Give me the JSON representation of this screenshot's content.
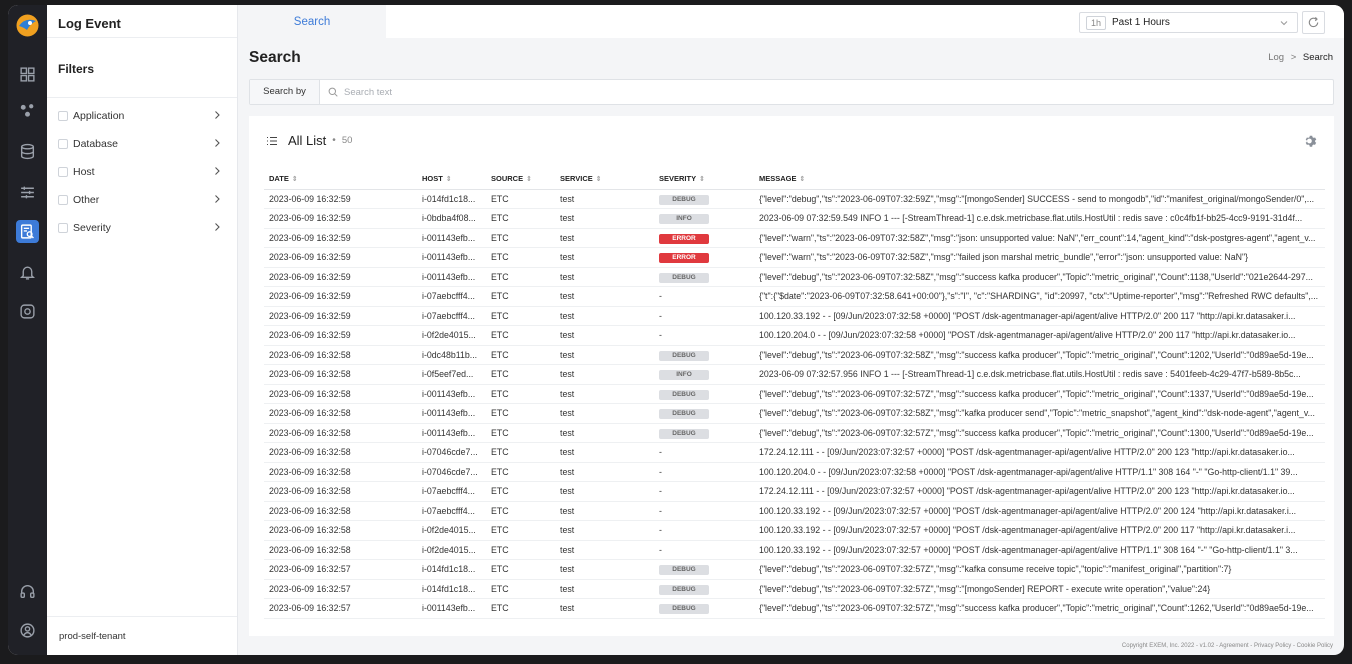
{
  "app": {
    "title": "Log Event",
    "tenant": "prod-self-tenant"
  },
  "filters": {
    "title": "Filters",
    "items": [
      {
        "label": "Application"
      },
      {
        "label": "Database"
      },
      {
        "label": "Host"
      },
      {
        "label": "Other"
      },
      {
        "label": "Severity"
      }
    ]
  },
  "topbar": {
    "tab_label": "Search",
    "time_badge": "1h",
    "time_label": "Past 1 Hours"
  },
  "page": {
    "title": "Search",
    "breadcrumb": {
      "root": "Log",
      "sep": ">",
      "current": "Search"
    }
  },
  "search": {
    "by_label": "Search by",
    "placeholder": "Search text"
  },
  "list": {
    "title": "All List",
    "dot": "•",
    "count": "50",
    "columns": [
      "DATE",
      "HOST",
      "SOURCE",
      "SERVICE",
      "SEVERITY",
      "MESSAGE"
    ],
    "sort_glyph": "⇕",
    "rows": [
      {
        "date": "2023-06-09 16:32:59",
        "host": "i-014fd1c18...",
        "source": "ETC",
        "service": "test",
        "severity": "DEBUG",
        "message": "{\"level\":\"debug\",\"ts\":\"2023-06-09T07:32:59Z\",\"msg\":\"[mongoSender] SUCCESS - send to mongodb\",\"id\":\"manifest_original/mongoSender/0\",..."
      },
      {
        "date": "2023-06-09 16:32:59",
        "host": "i-0bdba4f08...",
        "source": "ETC",
        "service": "test",
        "severity": "INFO",
        "message": "2023-06-09 07:32:59.549 INFO 1 --- [-StreamThread-1] c.e.dsk.metricbase.flat.utils.HostUtil : redis save : c0c4fb1f-bb25-4cc9-9191-31d4f..."
      },
      {
        "date": "2023-06-09 16:32:59",
        "host": "i-001143efb...",
        "source": "ETC",
        "service": "test",
        "severity": "ERROR",
        "message": "{\"level\":\"warn\",\"ts\":\"2023-06-09T07:32:58Z\",\"msg\":\"json: unsupported value: NaN\",\"err_count\":14,\"agent_kind\":\"dsk-postgres-agent\",\"agent_v..."
      },
      {
        "date": "2023-06-09 16:32:59",
        "host": "i-001143efb...",
        "source": "ETC",
        "service": "test",
        "severity": "ERROR",
        "message": "{\"level\":\"warn\",\"ts\":\"2023-06-09T07:32:58Z\",\"msg\":\"failed json marshal metric_bundle\",\"error\":\"json: unsupported value: NaN\"}"
      },
      {
        "date": "2023-06-09 16:32:59",
        "host": "i-001143efb...",
        "source": "ETC",
        "service": "test",
        "severity": "DEBUG",
        "message": "{\"level\":\"debug\",\"ts\":\"2023-06-09T07:32:58Z\",\"msg\":\"success kafka producer\",\"Topic\":\"metric_original\",\"Count\":1138,\"UserId\":\"021e2644-297..."
      },
      {
        "date": "2023-06-09 16:32:59",
        "host": "i-07aebcfff4...",
        "source": "ETC",
        "service": "test",
        "severity": "-",
        "message": "{\"t\":{\"$date\":\"2023-06-09T07:32:58.641+00:00\"},\"s\":\"I\", \"c\":\"SHARDING\", \"id\":20997, \"ctx\":\"Uptime-reporter\",\"msg\":\"Refreshed RWC defaults\",..."
      },
      {
        "date": "2023-06-09 16:32:59",
        "host": "i-07aebcfff4...",
        "source": "ETC",
        "service": "test",
        "severity": "-",
        "message": "100.120.33.192 - - [09/Jun/2023:07:32:58 +0000] \"POST /dsk-agentmanager-api/agent/alive HTTP/2.0\" 200 117 \"http://api.kr.datasaker.i..."
      },
      {
        "date": "2023-06-09 16:32:59",
        "host": "i-0f2de4015...",
        "source": "ETC",
        "service": "test",
        "severity": "-",
        "message": "100.120.204.0 - - [09/Jun/2023:07:32:58 +0000] \"POST /dsk-agentmanager-api/agent/alive HTTP/2.0\" 200 117 \"http://api.kr.datasaker.io..."
      },
      {
        "date": "2023-06-09 16:32:58",
        "host": "i-0dc48b11b...",
        "source": "ETC",
        "service": "test",
        "severity": "DEBUG",
        "message": "{\"level\":\"debug\",\"ts\":\"2023-06-09T07:32:58Z\",\"msg\":\"success kafka producer\",\"Topic\":\"metric_original\",\"Count\":1202,\"UserId\":\"0d89ae5d-19e..."
      },
      {
        "date": "2023-06-09 16:32:58",
        "host": "i-0f5eef7ed...",
        "source": "ETC",
        "service": "test",
        "severity": "INFO",
        "message": "2023-06-09 07:32:57.956 INFO 1 --- [-StreamThread-1] c.e.dsk.metricbase.flat.utils.HostUtil : redis save : 5401feeb-4c29-47f7-b589-8b5c..."
      },
      {
        "date": "2023-06-09 16:32:58",
        "host": "i-001143efb...",
        "source": "ETC",
        "service": "test",
        "severity": "DEBUG",
        "message": "{\"level\":\"debug\",\"ts\":\"2023-06-09T07:32:57Z\",\"msg\":\"success kafka producer\",\"Topic\":\"metric_original\",\"Count\":1337,\"UserId\":\"0d89ae5d-19e..."
      },
      {
        "date": "2023-06-09 16:32:58",
        "host": "i-001143efb...",
        "source": "ETC",
        "service": "test",
        "severity": "DEBUG",
        "message": "{\"level\":\"debug\",\"ts\":\"2023-06-09T07:32:58Z\",\"msg\":\"kafka producer send\",\"Topic\":\"metric_snapshot\",\"agent_kind\":\"dsk-node-agent\",\"agent_v..."
      },
      {
        "date": "2023-06-09 16:32:58",
        "host": "i-001143efb...",
        "source": "ETC",
        "service": "test",
        "severity": "DEBUG",
        "message": "{\"level\":\"debug\",\"ts\":\"2023-06-09T07:32:57Z\",\"msg\":\"success kafka producer\",\"Topic\":\"metric_original\",\"Count\":1300,\"UserId\":\"0d89ae5d-19e..."
      },
      {
        "date": "2023-06-09 16:32:58",
        "host": "i-07046cde7...",
        "source": "ETC",
        "service": "test",
        "severity": "-",
        "message": "172.24.12.111 - - [09/Jun/2023:07:32:57 +0000] \"POST /dsk-agentmanager-api/agent/alive HTTP/2.0\" 200 123 \"http://api.kr.datasaker.io..."
      },
      {
        "date": "2023-06-09 16:32:58",
        "host": "i-07046cde7...",
        "source": "ETC",
        "service": "test",
        "severity": "-",
        "message": "100.120.204.0 - - [09/Jun/2023:07:32:58 +0000] \"POST /dsk-agentmanager-api/agent/alive HTTP/1.1\" 308 164 \"-\" \"Go-http-client/1.1\" 39..."
      },
      {
        "date": "2023-06-09 16:32:58",
        "host": "i-07aebcfff4...",
        "source": "ETC",
        "service": "test",
        "severity": "-",
        "message": "172.24.12.111 - - [09/Jun/2023:07:32:57 +0000] \"POST /dsk-agentmanager-api/agent/alive HTTP/2.0\" 200 123 \"http://api.kr.datasaker.io..."
      },
      {
        "date": "2023-06-09 16:32:58",
        "host": "i-07aebcfff4...",
        "source": "ETC",
        "service": "test",
        "severity": "-",
        "message": "100.120.33.192 - - [09/Jun/2023:07:32:57 +0000] \"POST /dsk-agentmanager-api/agent/alive HTTP/2.0\" 200 124 \"http://api.kr.datasaker.i..."
      },
      {
        "date": "2023-06-09 16:32:58",
        "host": "i-0f2de4015...",
        "source": "ETC",
        "service": "test",
        "severity": "-",
        "message": "100.120.33.192 - - [09/Jun/2023:07:32:57 +0000] \"POST /dsk-agentmanager-api/agent/alive HTTP/2.0\" 200 117 \"http://api.kr.datasaker.i..."
      },
      {
        "date": "2023-06-09 16:32:58",
        "host": "i-0f2de4015...",
        "source": "ETC",
        "service": "test",
        "severity": "-",
        "message": "100.120.33.192 - - [09/Jun/2023:07:32:57 +0000] \"POST /dsk-agentmanager-api/agent/alive HTTP/1.1\" 308 164 \"-\" \"Go-http-client/1.1\" 3..."
      },
      {
        "date": "2023-06-09 16:32:57",
        "host": "i-014fd1c18...",
        "source": "ETC",
        "service": "test",
        "severity": "DEBUG",
        "message": "{\"level\":\"debug\",\"ts\":\"2023-06-09T07:32:57Z\",\"msg\":\"kafka consume receive topic\",\"topic\":\"manifest_original\",\"partition\":7}"
      },
      {
        "date": "2023-06-09 16:32:57",
        "host": "i-014fd1c18...",
        "source": "ETC",
        "service": "test",
        "severity": "DEBUG",
        "message": "{\"level\":\"debug\",\"ts\":\"2023-06-09T07:32:57Z\",\"msg\":\"[mongoSender] REPORT - execute write operation\",\"value\":24}"
      },
      {
        "date": "2023-06-09 16:32:57",
        "host": "i-001143efb...",
        "source": "ETC",
        "service": "test",
        "severity": "DEBUG",
        "message": "{\"level\":\"debug\",\"ts\":\"2023-06-09T07:32:57Z\",\"msg\":\"success kafka producer\",\"Topic\":\"metric_original\",\"Count\":1262,\"UserId\":\"0d89ae5d-19e..."
      }
    ]
  },
  "footer": "Copyright EXEM, Inc. 2022 - v1.02 - Agreement - Privacy Policy - Cookie Policy",
  "colors": {
    "accent": "#3d7bd8",
    "rail": "#202127",
    "error": "#e0393e"
  }
}
